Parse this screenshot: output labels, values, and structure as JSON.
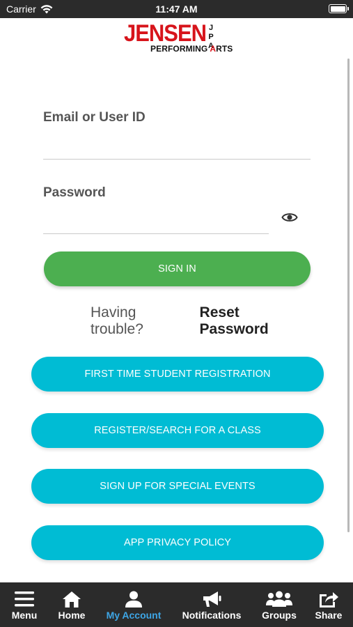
{
  "status_bar": {
    "carrier": "Carrier",
    "time": "11:47 AM"
  },
  "logo": {
    "main": "JENSEN",
    "side": [
      "J",
      "P",
      "A"
    ],
    "sub_black": "PERFORMING ",
    "sub_red": "A",
    "sub_rest": "RTS"
  },
  "form": {
    "email_label": "Email or User ID",
    "email_value": "",
    "password_label": "Password",
    "password_value": "",
    "sign_in": "SIGN IN",
    "trouble_text": "Having trouble?",
    "reset_link": "Reset Password"
  },
  "actions": [
    {
      "label": "FIRST TIME STUDENT REGISTRATION"
    },
    {
      "label": "REGISTER/SEARCH FOR A CLASS"
    },
    {
      "label": "SIGN UP FOR SPECIAL EVENTS"
    },
    {
      "label": "APP PRIVACY POLICY"
    }
  ],
  "tabs": [
    {
      "label": "Menu",
      "icon": "menu-icon"
    },
    {
      "label": "Home",
      "icon": "home-icon"
    },
    {
      "label": "My Account",
      "icon": "user-icon",
      "active": true
    },
    {
      "label": "Notifications",
      "icon": "megaphone-icon"
    },
    {
      "label": "Groups",
      "icon": "groups-icon"
    },
    {
      "label": "Share",
      "icon": "share-icon"
    }
  ],
  "colors": {
    "accent_green": "#4caf50",
    "accent_cyan": "#00bcd4",
    "active_tab": "#3ea6e6",
    "brand_red": "#d7141b"
  }
}
